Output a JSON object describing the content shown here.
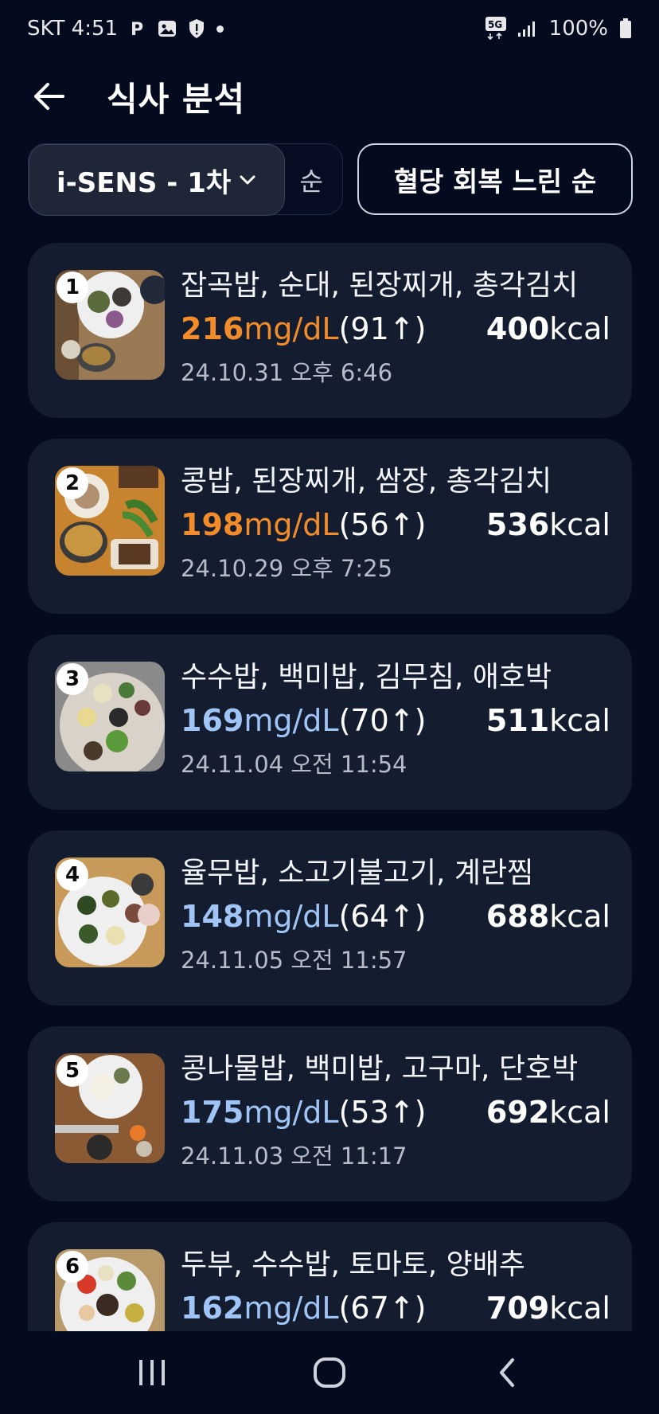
{
  "status_bar": {
    "carrier_time": "SKT 4:51",
    "p_label": "P",
    "network": "5G",
    "battery": "100%"
  },
  "header": {
    "title": "식사 분석"
  },
  "filters": {
    "device": "i-SENS - 1차",
    "hidden_suffix": "순",
    "sort": "혈당 회복 느린 순"
  },
  "colors": {
    "high": "#f28c2a",
    "normal": "#9fc4f5"
  },
  "meals": [
    {
      "rank": "1",
      "name": "잡곡밥, 순대, 된장찌개, 총각김치",
      "glucose": "216",
      "unit": "mg/dL",
      "delta": "(91↑)",
      "kcal": "400",
      "kcal_unit": "kcal",
      "date": "24.10.31 오후 6:46",
      "level": "high"
    },
    {
      "rank": "2",
      "name": "콩밥, 된장찌개, 쌈장, 총각김치",
      "glucose": "198",
      "unit": "mg/dL",
      "delta": "(56↑)",
      "kcal": "536",
      "kcal_unit": "kcal",
      "date": "24.10.29 오후 7:25",
      "level": "high"
    },
    {
      "rank": "3",
      "name": "수수밥, 백미밥, 김무침, 애호박",
      "glucose": "169",
      "unit": "mg/dL",
      "delta": "(70↑)",
      "kcal": "511",
      "kcal_unit": "kcal",
      "date": "24.11.04 오전 11:54",
      "level": "normal"
    },
    {
      "rank": "4",
      "name": "율무밥, 소고기불고기, 계란찜",
      "glucose": "148",
      "unit": "mg/dL",
      "delta": "(64↑)",
      "kcal": "688",
      "kcal_unit": "kcal",
      "date": "24.11.05 오전 11:57",
      "level": "normal"
    },
    {
      "rank": "5",
      "name": "콩나물밥, 백미밥, 고구마, 단호박",
      "glucose": "175",
      "unit": "mg/dL",
      "delta": "(53↑)",
      "kcal": "692",
      "kcal_unit": "kcal",
      "date": "24.11.03 오전 11:17",
      "level": "normal"
    },
    {
      "rank": "6",
      "name": "두부, 수수밥, 토마토, 양배추",
      "glucose": "162",
      "unit": "mg/dL",
      "delta": "(67↑)",
      "kcal": "709",
      "kcal_unit": "kcal",
      "date": "",
      "level": "normal"
    }
  ],
  "icons": {
    "back": "arrow-left-icon",
    "dropdown": "chevron-down-icon",
    "nav_recent": "recent-apps-icon",
    "nav_home": "home-icon",
    "nav_back": "back-icon"
  }
}
